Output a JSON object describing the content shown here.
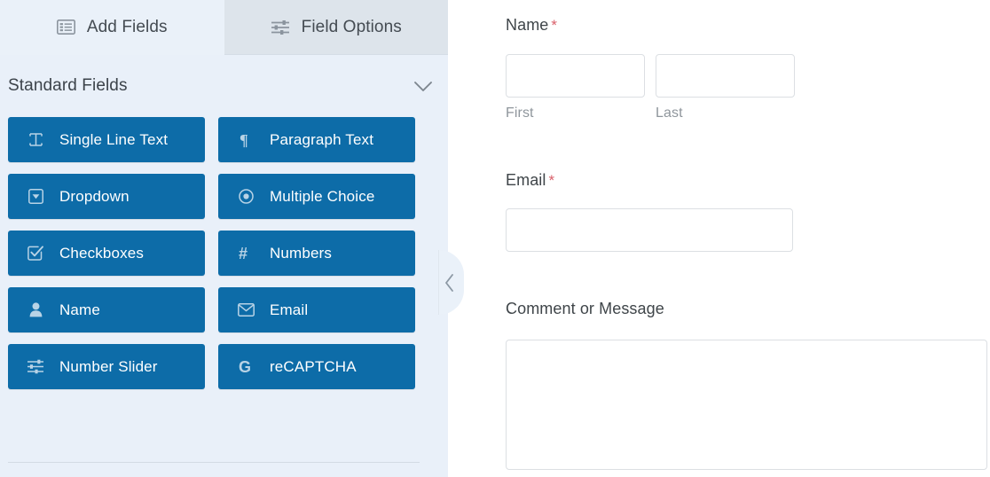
{
  "builder": {
    "tabs": [
      {
        "label": "Add Fields",
        "icon": "list-panel-icon",
        "active": true
      },
      {
        "label": "Field Options",
        "icon": "sliders-icon",
        "active": false
      }
    ],
    "section": {
      "title": "Standard Fields",
      "toggle_icon": "chevron-down-icon",
      "expanded": true
    },
    "fields": [
      {
        "label": "Single Line Text",
        "icon": "text-cursor-icon"
      },
      {
        "label": "Paragraph Text",
        "icon": "pilcrow-icon"
      },
      {
        "label": "Dropdown",
        "icon": "dropdown-caret-icon"
      },
      {
        "label": "Multiple Choice",
        "icon": "radio-button-icon"
      },
      {
        "label": "Checkboxes",
        "icon": "checkbox-checked-icon"
      },
      {
        "label": "Numbers",
        "icon": "hash-icon"
      },
      {
        "label": "Name",
        "icon": "user-icon"
      },
      {
        "label": "Email",
        "icon": "envelope-icon"
      },
      {
        "label": "Number Slider",
        "icon": "sliders-icon"
      },
      {
        "label": "reCAPTCHA",
        "icon": "google-g-icon"
      }
    ],
    "collapse_handle": {
      "icon": "chevron-left-icon",
      "title": "Collapse panel"
    }
  },
  "preview": {
    "fields": [
      {
        "type": "name",
        "label": "Name",
        "required_marker": "*",
        "required": true,
        "inputs": [
          {
            "value": "",
            "placeholder": "",
            "sublabel": "First"
          },
          {
            "value": "",
            "placeholder": "",
            "sublabel": "Last"
          }
        ]
      },
      {
        "type": "email",
        "label": "Email",
        "required_marker": "*",
        "required": true,
        "inputs": [
          {
            "value": "",
            "placeholder": ""
          }
        ]
      },
      {
        "type": "textarea",
        "label": "Comment or Message",
        "required_marker": "",
        "required": false,
        "inputs": [
          {
            "value": "",
            "placeholder": ""
          }
        ]
      }
    ]
  },
  "colors": {
    "field_button_blue": "#0d6ca8",
    "panel_background": "#e9f0f9",
    "active_tab_background": "#eaf1f9",
    "inactive_tab_background": "#dde4eb",
    "required_star": "#d9606a",
    "scrollbar_thumb": "#6a6a6a"
  }
}
